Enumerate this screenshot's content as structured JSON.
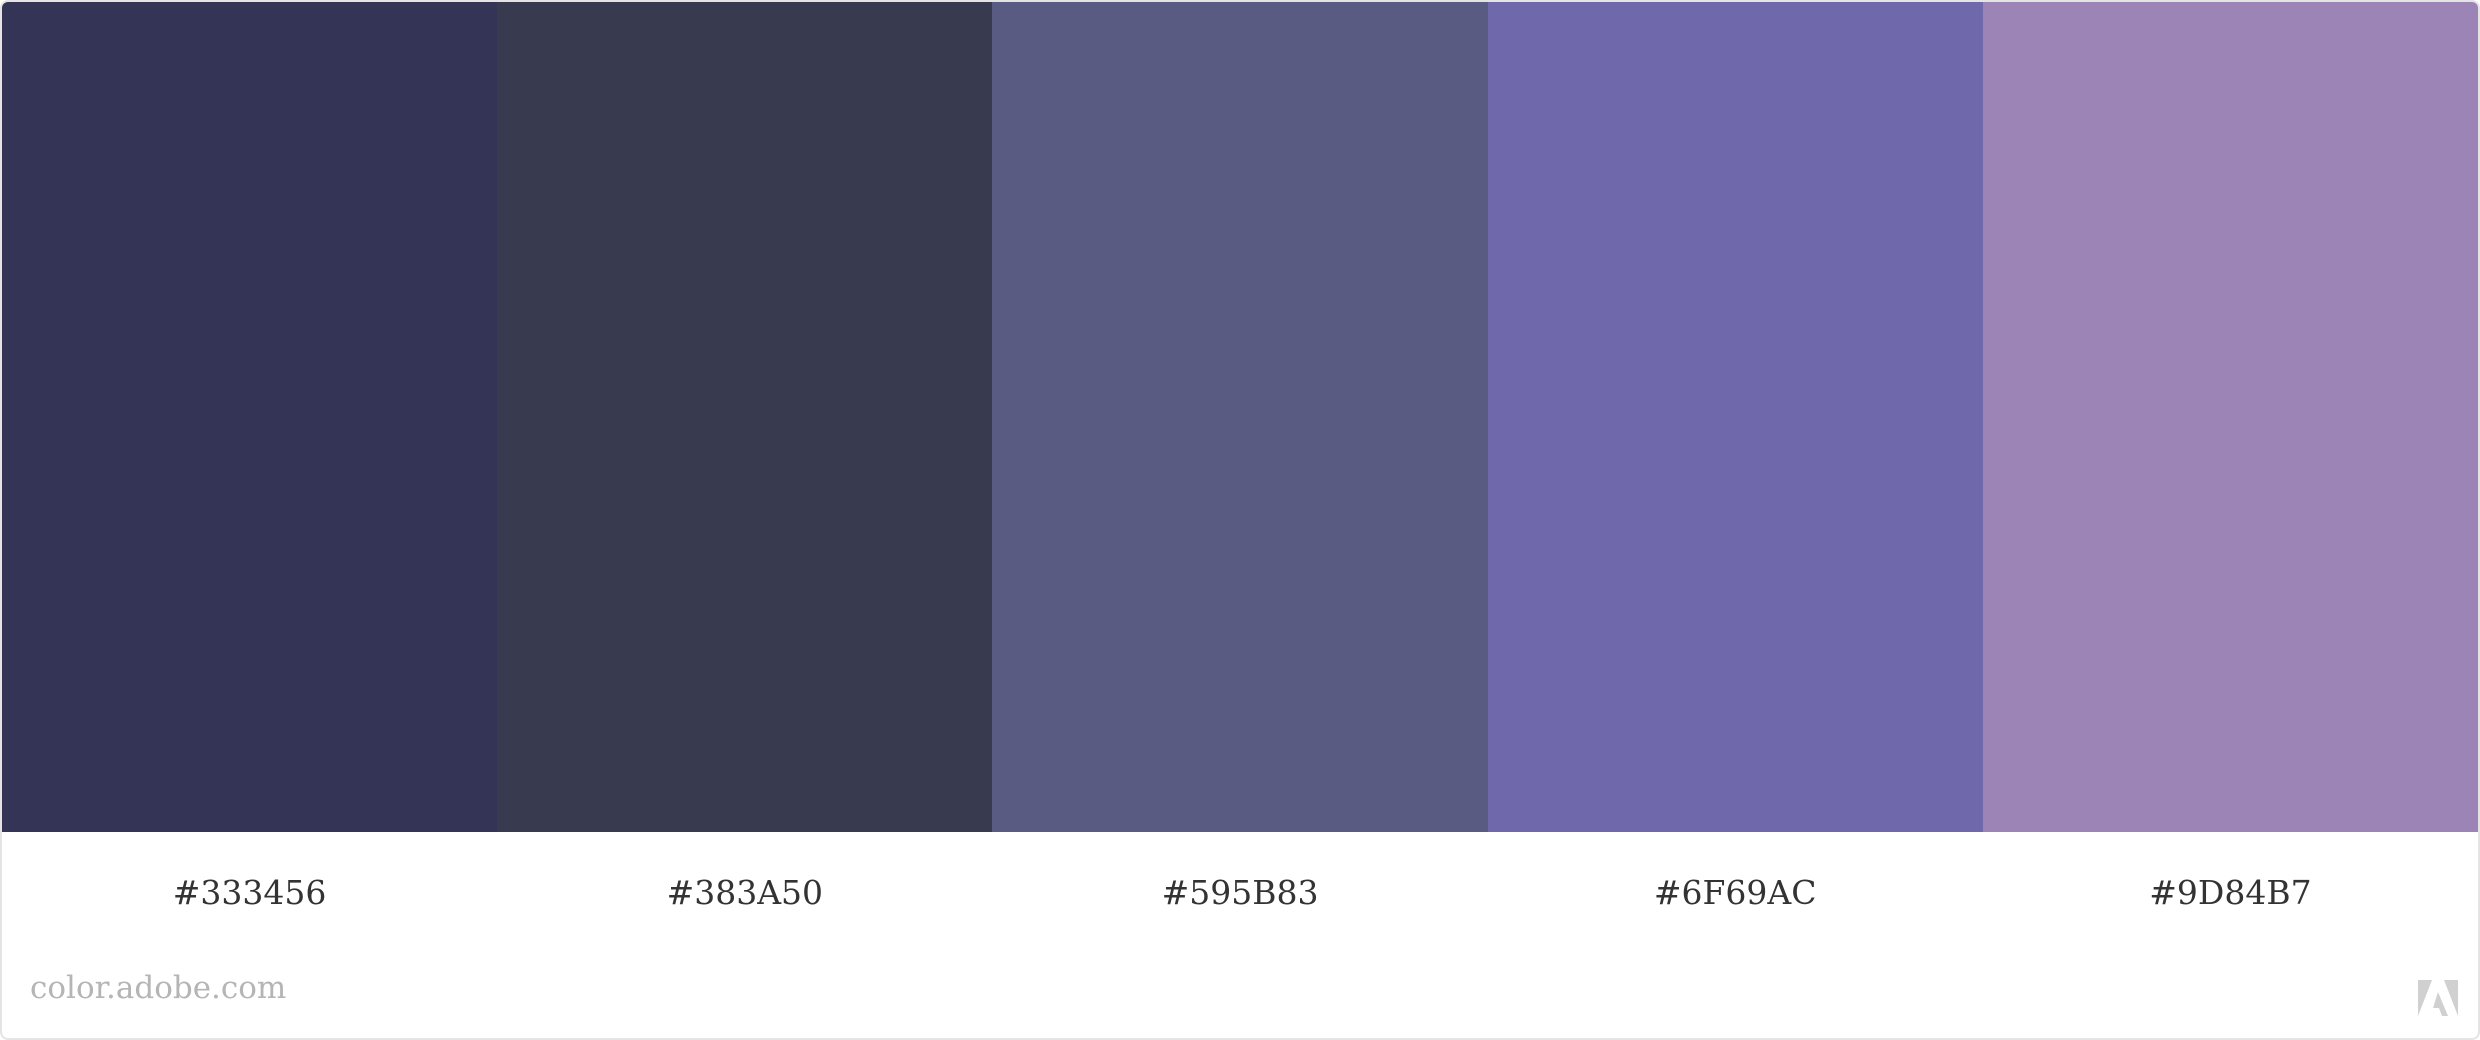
{
  "swatches": [
    {
      "hex": "#333456",
      "label": "#333456"
    },
    {
      "hex": "#383A50",
      "label": "#383A50"
    },
    {
      "hex": "#595B83",
      "label": "#595B83"
    },
    {
      "hex": "#6F69AC",
      "label": "#6F69AC"
    },
    {
      "hex": "#9D84B7",
      "label": "#9D84B7"
    }
  ],
  "footer": {
    "site": "color.adobe.com",
    "logo_icon": "adobe-logo-icon",
    "logo_color": "#d0d0d0"
  }
}
